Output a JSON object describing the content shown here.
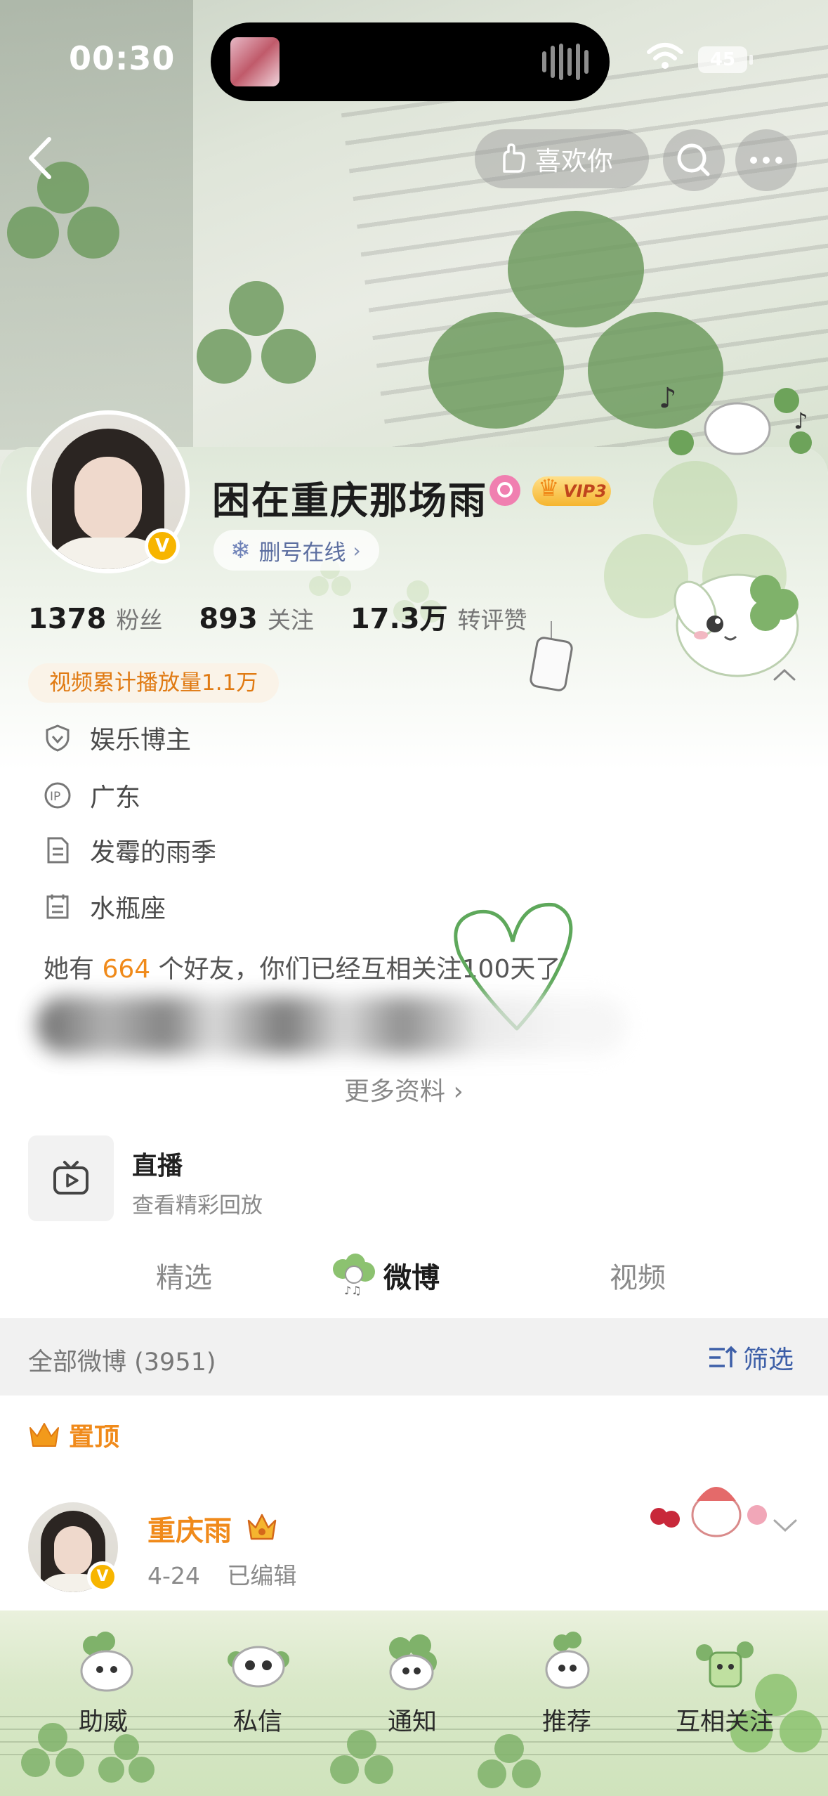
{
  "status": {
    "time": "00:30",
    "battery": "45"
  },
  "nav": {
    "like_label": "喜欢你"
  },
  "profile": {
    "name": "困在重庆那场雨",
    "vip_label": "VIP3",
    "online_label": "删号在线",
    "stats": [
      {
        "num": "1378",
        "label": "粉丝"
      },
      {
        "num": "893",
        "label": "关注"
      },
      {
        "num": "17.3万",
        "label": "转评赞"
      }
    ],
    "play_count": "视频累计播放量1.1万",
    "info": [
      {
        "icon": "shield-icon",
        "text": "娱乐博主"
      },
      {
        "icon": "ip-icon",
        "text": "广东"
      },
      {
        "icon": "document-icon",
        "text": "发霉的雨季"
      },
      {
        "icon": "calendar-icon",
        "text": "水瓶座"
      }
    ],
    "friends": {
      "prefix": "她有",
      "count": "664",
      "suffix": "个好友，你们已经互相关注100天了"
    },
    "more_info": "更多资料"
  },
  "live": {
    "title": "直播",
    "subtitle": "查看精彩回放"
  },
  "tabs": [
    {
      "label": "精选",
      "active": false
    },
    {
      "label": "微博",
      "active": true
    },
    {
      "label": "视频",
      "active": false
    }
  ],
  "feed": {
    "all_label": "全部微博 (3951)",
    "filter_label": "筛选",
    "pinned_label": "置顶",
    "post": {
      "author": "重庆雨",
      "date": "4-24",
      "edited": "已编辑"
    }
  },
  "bottom_bar": [
    {
      "label": "助威"
    },
    {
      "label": "私信"
    },
    {
      "label": "通知"
    },
    {
      "label": "推荐"
    },
    {
      "label": "互相关注"
    }
  ],
  "colors": {
    "accent_orange": "#f08a1a",
    "link_blue": "#3d5fa8",
    "verified_gold": "#f7b500"
  }
}
